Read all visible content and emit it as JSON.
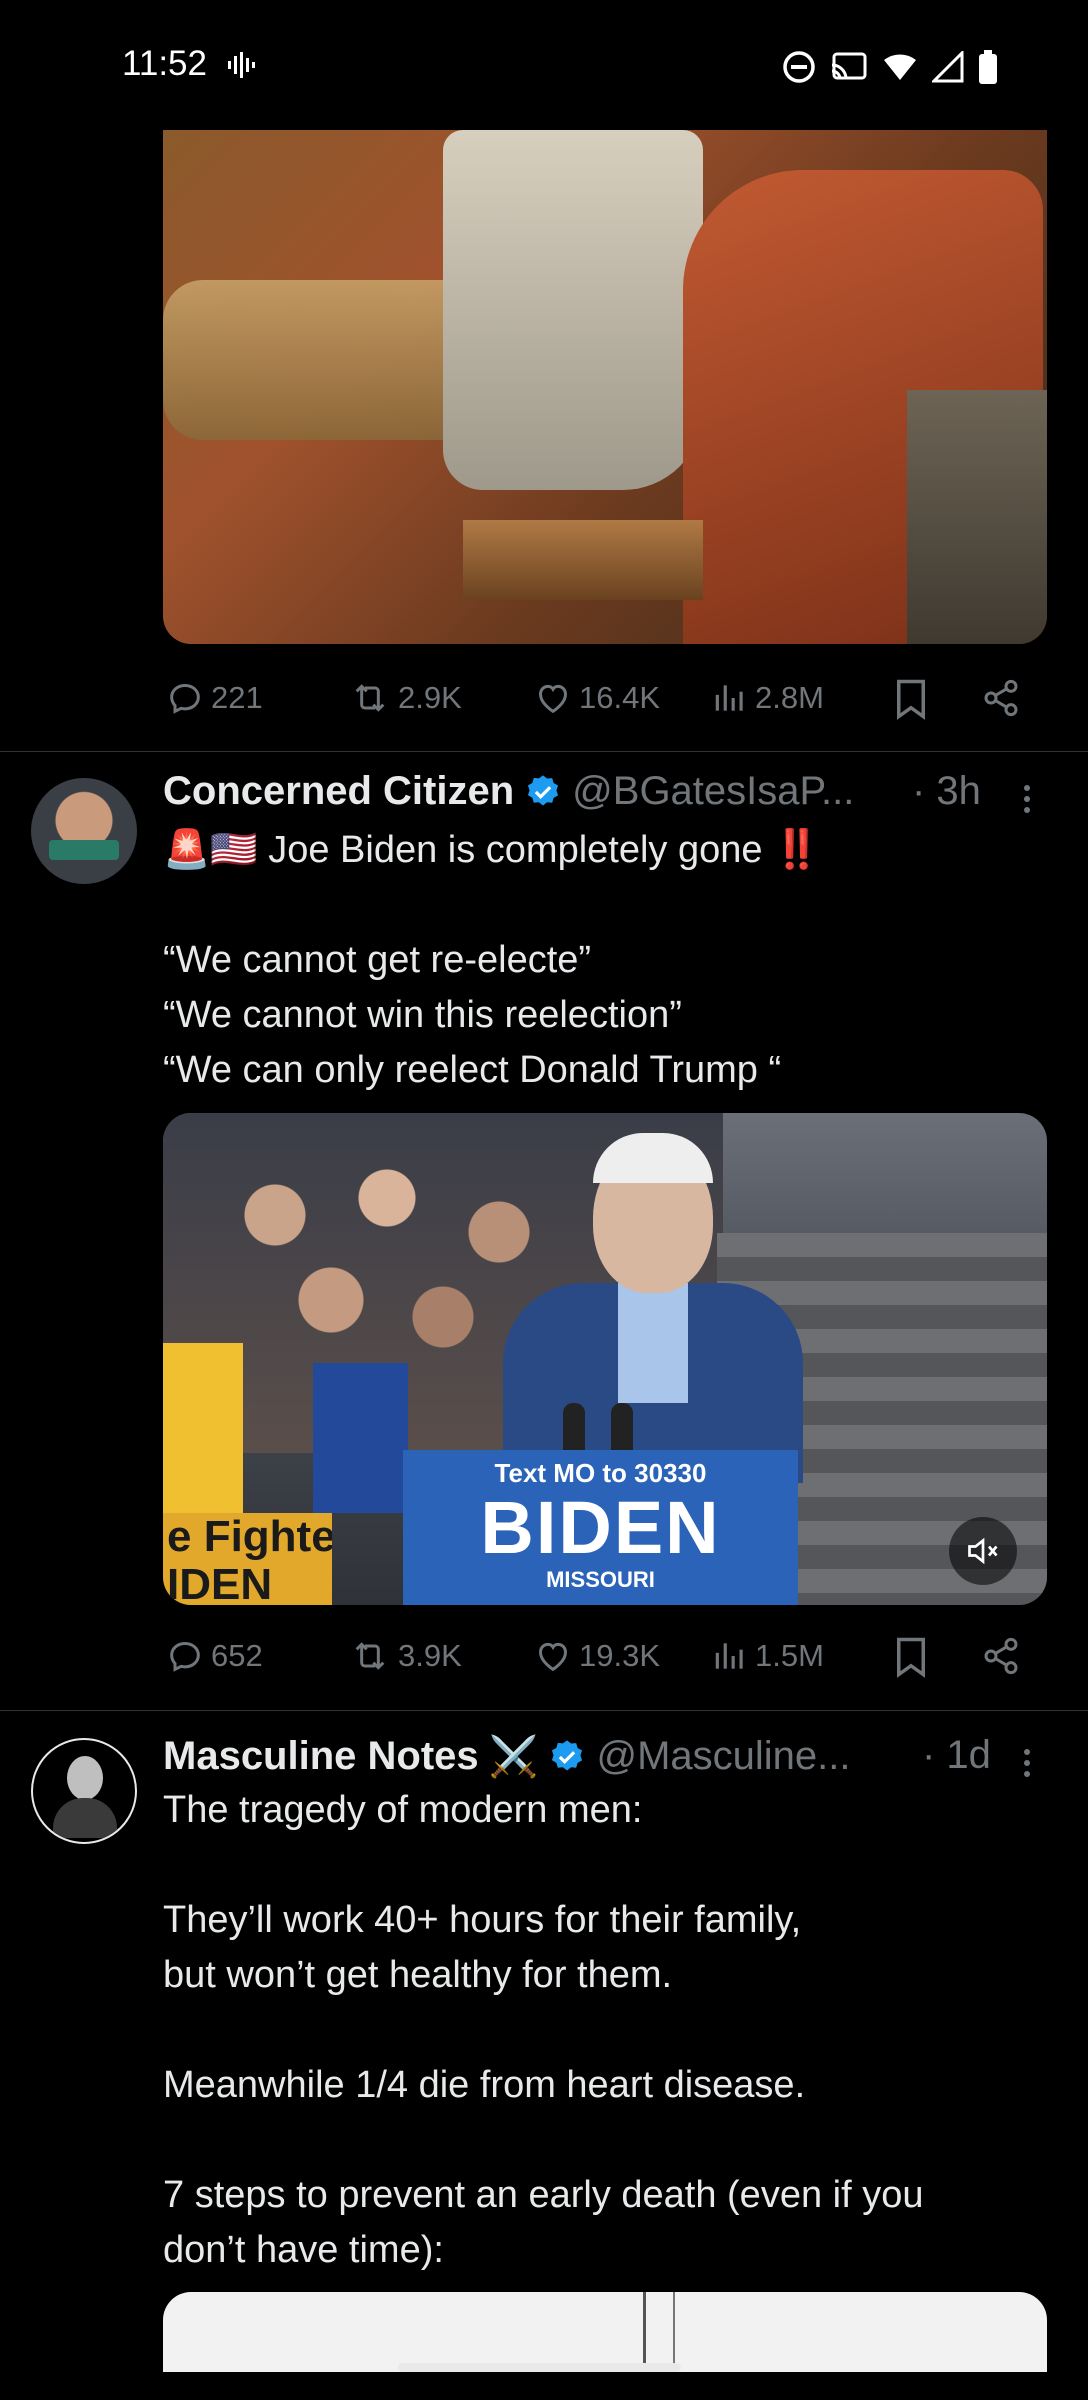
{
  "status_bar": {
    "time": "11:52"
  },
  "tweet1": {
    "actions": {
      "replies": "221",
      "reposts": "2.9K",
      "likes": "16.4K",
      "views": "2.8M"
    }
  },
  "tweet2": {
    "name": "Concerned Citizen",
    "handle": "@BGatesIsaP...",
    "time": "· 3h",
    "emoji_prefix": "🚨🇺🇸",
    "lines": [
      "Joe Biden is completely gone",
      "",
      "“We cannot get re-electe”",
      "“We cannot win this reelection”",
      "“We can only reelect Donald Trump “"
    ],
    "emoji_suffix": "‼️",
    "video": {
      "podium_small": "Text MO to 30330",
      "podium_big": "BIDEN",
      "podium_state": "MISSOURI",
      "sign": "e Fighters\nIDEN"
    },
    "actions": {
      "replies": "652",
      "reposts": "3.9K",
      "likes": "19.3K",
      "views": "1.5M"
    }
  },
  "tweet3": {
    "name": "Masculine Notes",
    "name_emoji": "⚔️",
    "handle": "@Masculine...",
    "time": "· 1d",
    "lines": [
      "The tragedy of modern men:",
      "",
      "They’ll work 40+ hours for their family,",
      "but won’t get healthy for them.",
      "",
      "Meanwhile 1/4 die from heart disease.",
      "",
      "7 steps to prevent an early death (even if you",
      "don’t have time):"
    ]
  },
  "colors": {
    "background": "#000000",
    "text": "#e7e9ea",
    "muted": "#71767b",
    "verified": "#1d9bf0",
    "divider": "#2f3336"
  }
}
